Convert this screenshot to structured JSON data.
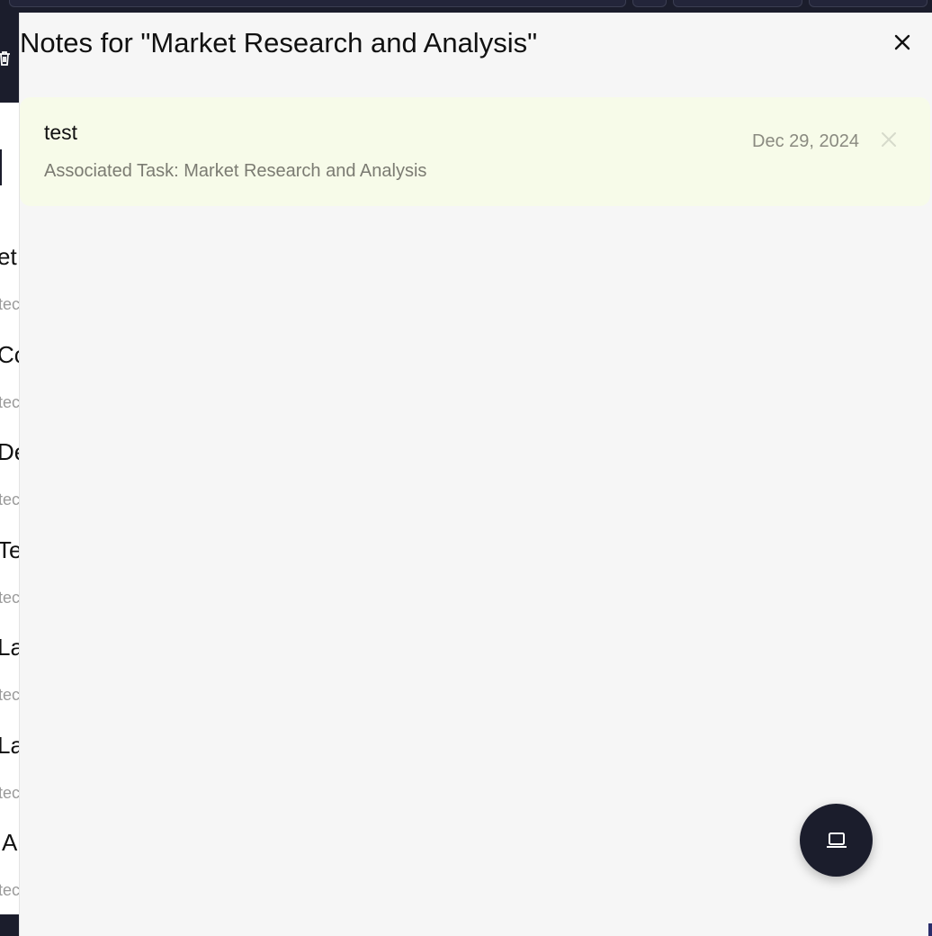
{
  "background_page": {
    "row_titles": [
      "et",
      "Co",
      "De",
      "Te",
      "La",
      "La",
      "A"
    ],
    "row_subtitles": [
      "tec",
      "tec",
      "tec",
      "tec",
      "tec",
      "tec",
      "tec"
    ]
  },
  "drawer": {
    "title": "Notes for \"Market Research and Analysis\"",
    "close_icon": "close-icon"
  },
  "notes": [
    {
      "title": "test",
      "associated": "Associated Task: Market Research and Analysis",
      "date": "Dec 29, 2024"
    }
  ],
  "fab": {
    "icon": "laptop-icon"
  },
  "colors": {
    "drawer_bg": "#f6f6f6",
    "note_bg": "#f7fbe9",
    "dark": "#1b1d2c"
  }
}
